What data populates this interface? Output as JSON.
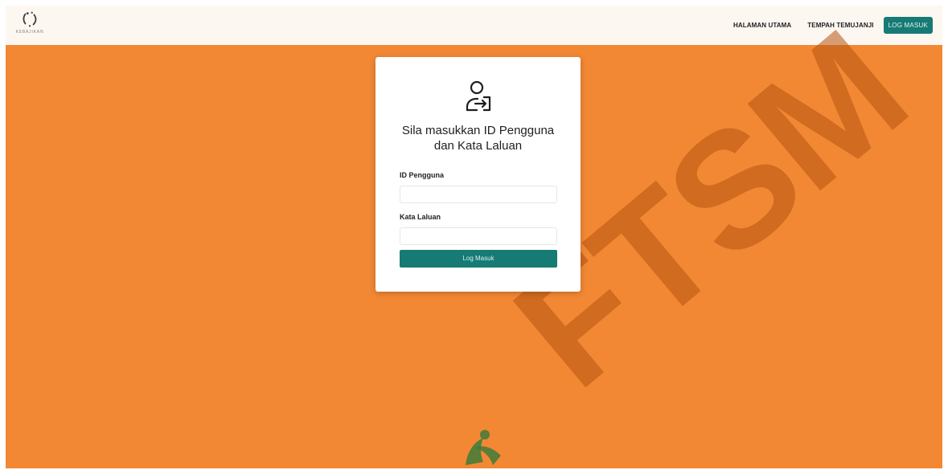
{
  "brand": {
    "logo_text": "KEBAJIKAN",
    "logo_icon": "leaf-wreath-icon"
  },
  "nav": {
    "links": [
      "HALAMAN UTAMA",
      "TEMPAH TEMUJANJI"
    ],
    "login_button": "LOG MASUK"
  },
  "login_card": {
    "icon": "user-login-icon",
    "title": "Sila masukkan ID Pengguna dan Kata Laluan",
    "user_id_label": "ID Pengguna",
    "user_id_value": "",
    "password_label": "Kata Laluan",
    "password_value": "",
    "submit_label": "Log Masuk"
  },
  "watermark": {
    "text": "FTSM"
  },
  "colors": {
    "page_background": "#f28834",
    "navbar_background": "#fdf7f1",
    "accent": "#167a75",
    "watermark": "#b5540f"
  }
}
